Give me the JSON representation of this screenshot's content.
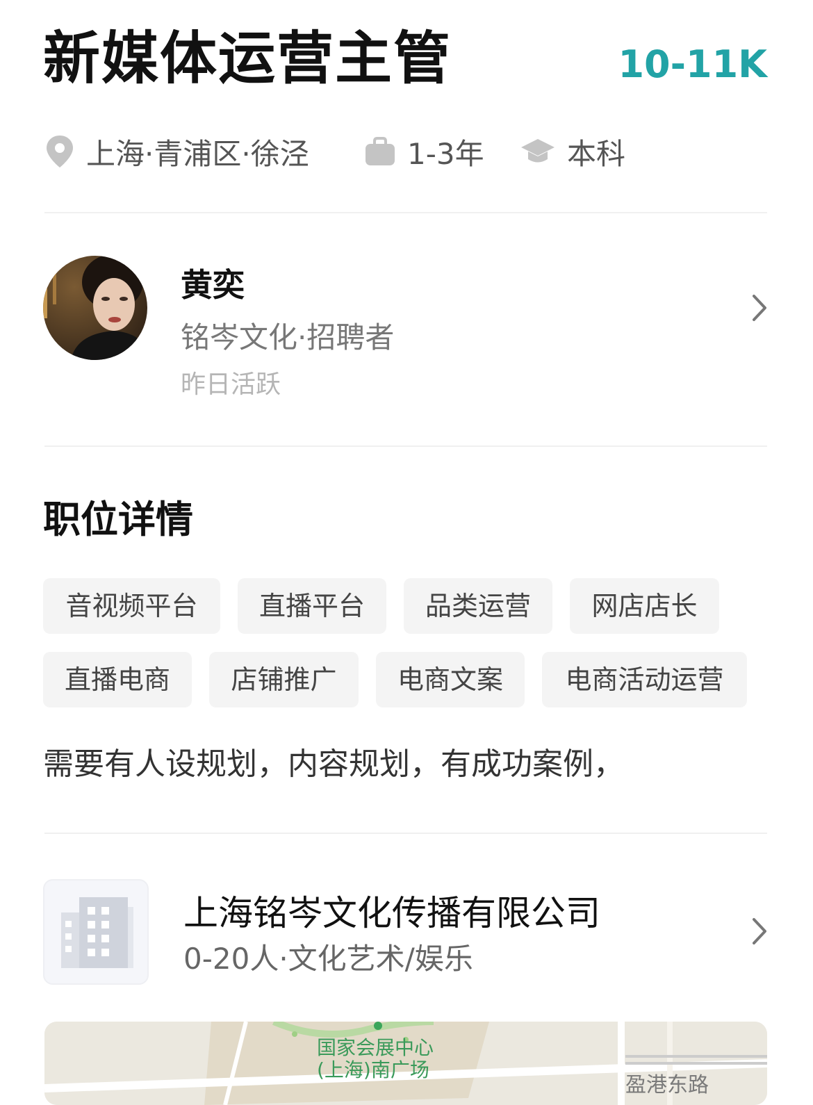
{
  "job": {
    "title": "新媒体运营主管",
    "salary": "10-11K",
    "location": "上海·青浦区·徐泾",
    "experience": "1-3年",
    "education": "本科"
  },
  "recruiter": {
    "name": "黄奕",
    "company_role": "铭岑文化·招聘者",
    "active_status": "昨日活跃"
  },
  "details": {
    "heading": "职位详情",
    "tags": [
      "音视频平台",
      "直播平台",
      "品类运营",
      "网店店长",
      "直播电商",
      "店铺推广",
      "电商文案",
      "电商活动运营"
    ],
    "description": "需要有人设规划，内容规划，有成功案例，"
  },
  "company": {
    "name": "上海铭岑文化传播有限公司",
    "info": "0-20人·文化艺术/娱乐"
  },
  "map": {
    "poi_line1": "国家会展中心",
    "poi_line2": "(上海)南广场",
    "road": "盈港东路"
  },
  "colors": {
    "salary": "#22a3a6",
    "tag_bg": "#f4f4f4",
    "icon_gray": "#c4c4c4"
  },
  "icons": [
    "location-pin-icon",
    "briefcase-icon",
    "graduation-cap-icon",
    "chevron-right-icon",
    "building-icon"
  ]
}
